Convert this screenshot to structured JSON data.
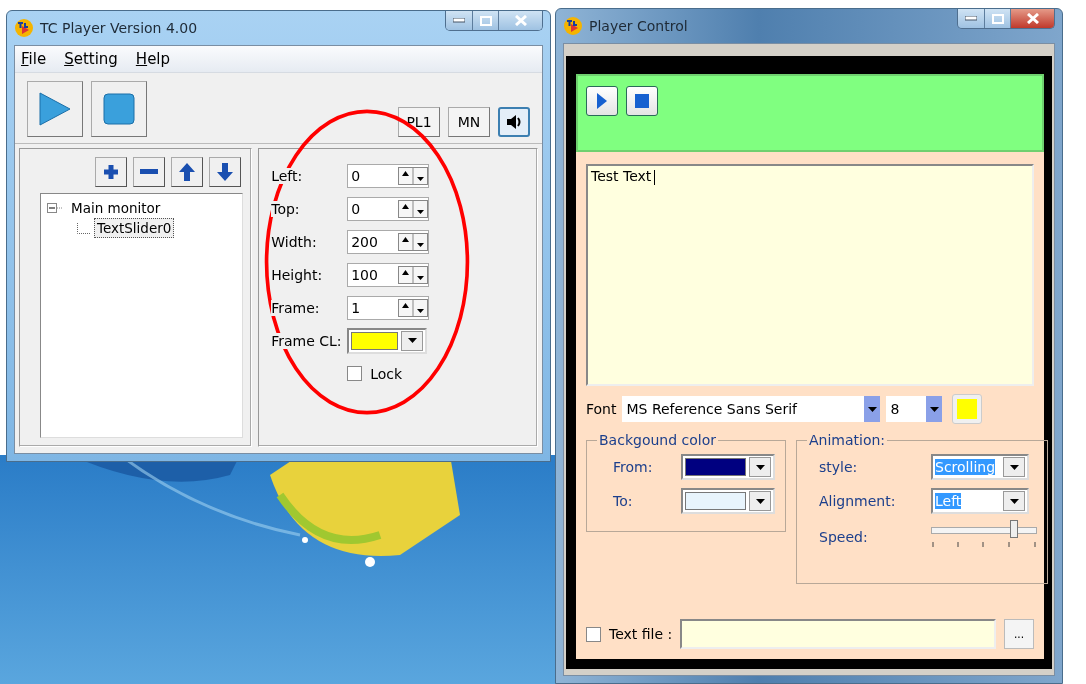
{
  "main_window": {
    "title": "TC Player Version 4.00",
    "menu": [
      {
        "label": "File"
      },
      {
        "label": "Setting"
      },
      {
        "label": "Help"
      }
    ],
    "toolbar_buttons": [
      {
        "label": "PL1"
      },
      {
        "label": "MN"
      }
    ],
    "sound_pressed": true,
    "tree": [
      {
        "label": "Main monitor",
        "expanded": true,
        "selected": false,
        "children": [
          {
            "label": "TextSlider0",
            "selected": true
          }
        ]
      }
    ],
    "properties": [
      {
        "kind": "spin",
        "label": "Left:",
        "value": "0"
      },
      {
        "kind": "spin",
        "label": "Top:",
        "value": "0"
      },
      {
        "kind": "spin",
        "label": "Width:",
        "value": "200"
      },
      {
        "kind": "spin",
        "label": "Height:",
        "value": "100"
      },
      {
        "kind": "spin",
        "label": "Frame:",
        "value": "1"
      },
      {
        "kind": "color",
        "label": "Frame CL:",
        "color": "#ffff00"
      }
    ],
    "lock": {
      "label": "Lock",
      "checked": false
    }
  },
  "player_control": {
    "title": "Player Control",
    "text": "Test Text",
    "font": {
      "label": "Font",
      "value": "MS Reference Sans Serif",
      "size": "8",
      "color": "#ffff00"
    },
    "background_color": {
      "title": "Backgound color",
      "rows": [
        {
          "label": "From:",
          "color": "#000080"
        },
        {
          "label": "To:",
          "color": "#e8f4fc"
        }
      ]
    },
    "animation": {
      "title": "Animation:",
      "style": {
        "label": "style:",
        "value": "Scrolling",
        "highlighted": true
      },
      "alignment": {
        "label": "Alignment:",
        "value": "Left",
        "highlighted": true
      },
      "speed": {
        "label": "Speed:",
        "level": 0.78
      }
    },
    "text_file": {
      "label": "Text file :",
      "checked": false,
      "browse": "..."
    }
  }
}
